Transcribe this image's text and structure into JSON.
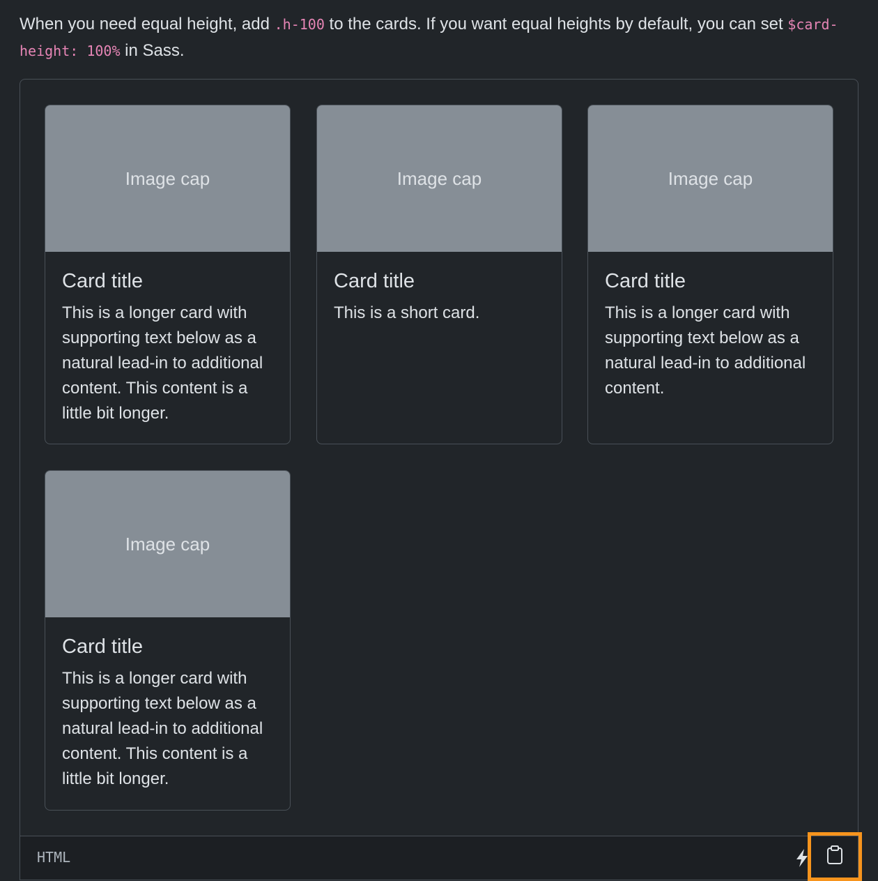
{
  "intro": {
    "text_1": "When you need equal height, add ",
    "code_1": ".h-100",
    "text_2": " to the cards. If you want equal heights by default, you can set ",
    "code_2": "$card-height: 100%",
    "text_3": " in Sass."
  },
  "cards": [
    {
      "image_cap": "Image cap",
      "title": "Card title",
      "text": "This is a longer card with supporting text below as a natural lead-in to additional content. This content is a little bit longer."
    },
    {
      "image_cap": "Image cap",
      "title": "Card title",
      "text": "This is a short card."
    },
    {
      "image_cap": "Image cap",
      "title": "Card title",
      "text": "This is a longer card with supporting text below as a natural lead-in to additional content."
    },
    {
      "image_cap": "Image cap",
      "title": "Card title",
      "text": "This is a longer card with supporting text below as a natural lead-in to additional content. This content is a little bit longer."
    }
  ],
  "code_bar": {
    "language": "HTML",
    "stackblitz_icon": "lightning-icon",
    "copy_icon": "clipboard-icon",
    "highlight_color": "#f7941d"
  },
  "colors": {
    "background": "#212529",
    "image_cap_bg": "#868e96",
    "code_pink": "#e685b5"
  }
}
